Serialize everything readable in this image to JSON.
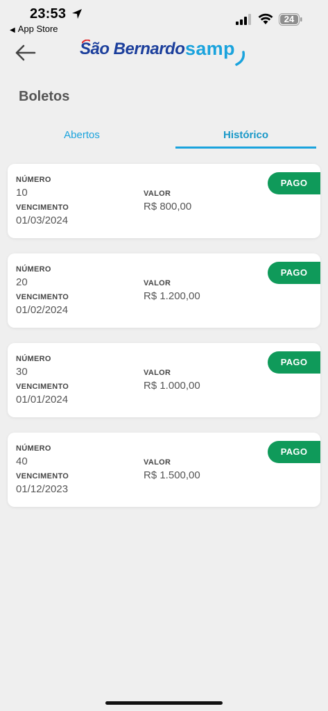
{
  "status_bar": {
    "time": "23:53",
    "back_app": "App Store",
    "battery": "24"
  },
  "header": {
    "logo_part1": "São Bernardo",
    "logo_part2": "samp",
    "title": "Boletos"
  },
  "tabs": [
    {
      "label": "Abertos",
      "active": false
    },
    {
      "label": "Histórico",
      "active": true
    }
  ],
  "labels": {
    "numero": "NÚMERO",
    "vencimento": "VENCIMENTO",
    "valor": "VALOR"
  },
  "boletos": [
    {
      "numero": "10",
      "vencimento": "01/03/2024",
      "valor": "R$ 800,00",
      "status": "PAGO"
    },
    {
      "numero": "20",
      "vencimento": "01/02/2024",
      "valor": "R$ 1.200,00",
      "status": "PAGO"
    },
    {
      "numero": "30",
      "vencimento": "01/01/2024",
      "valor": "R$ 1.000,00",
      "status": "PAGO"
    },
    {
      "numero": "40",
      "vencimento": "01/12/2023",
      "valor": "R$ 1.500,00",
      "status": "PAGO"
    }
  ],
  "colors": {
    "accent": "#1aa3dd",
    "brand_dark": "#1c3f9c",
    "paid": "#0f9a5a"
  }
}
